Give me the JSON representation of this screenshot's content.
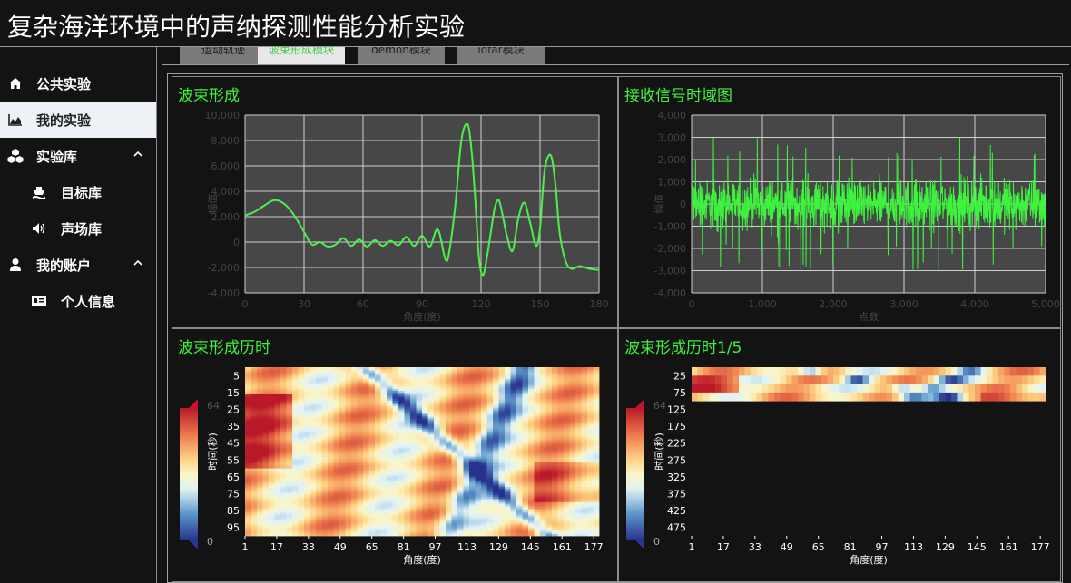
{
  "app": {
    "title": "复杂海洋环境中的声纳探测性能分析实验"
  },
  "sidebar": {
    "items": [
      {
        "label": "公共实验",
        "icon": "home-icon",
        "active": false,
        "sub": false
      },
      {
        "label": "我的实验",
        "icon": "area-chart-icon",
        "active": true,
        "sub": false
      },
      {
        "label": "实验库",
        "icon": "cubes-icon",
        "active": false,
        "sub": false,
        "expanded": true
      },
      {
        "label": "目标库",
        "icon": "ship-icon",
        "active": false,
        "sub": true
      },
      {
        "label": "声场库",
        "icon": "volume-icon",
        "active": false,
        "sub": true
      },
      {
        "label": "我的账户",
        "icon": "user-icon",
        "active": false,
        "sub": false,
        "expanded": true
      },
      {
        "label": "个人信息",
        "icon": "id-card-icon",
        "active": false,
        "sub": true
      }
    ]
  },
  "tabs": [
    {
      "label": "运动轨迹",
      "active": false
    },
    {
      "label": "波束形成模块",
      "active": true
    },
    {
      "label": "demon模块",
      "active": false
    },
    {
      "label": "lofar模块",
      "active": false
    }
  ],
  "colors": {
    "accent_green": "#3ef23e",
    "background": "#131313",
    "plot_bg": "#474747"
  },
  "chart_data": [
    {
      "type": "line",
      "title": "波束形成",
      "xlabel": "角度(度)",
      "ylabel": "幅值",
      "xlim": [
        0,
        180
      ],
      "ylim": [
        -4000,
        10000
      ],
      "xticks": [
        "0",
        "30",
        "60",
        "90",
        "120",
        "150",
        "180"
      ],
      "yticks": [
        "10,000",
        "8,000",
        "6,000",
        "4,000",
        "2,000",
        "0",
        "-2,000",
        "-4,000"
      ],
      "grid": true,
      "series": [
        {
          "color": "#4cf04c",
          "x": [
            0,
            5,
            10,
            15,
            20,
            25,
            30,
            34,
            38,
            42,
            46,
            50,
            54,
            58,
            62,
            66,
            70,
            74,
            78,
            82,
            86,
            90,
            94,
            98,
            102,
            104,
            107,
            110,
            113,
            115,
            117,
            119,
            121,
            123,
            125,
            127,
            129,
            131,
            133,
            136,
            139,
            142,
            145,
            148,
            150,
            152,
            154,
            156,
            158,
            160,
            163,
            166,
            170,
            175,
            180
          ],
          "y": [
            2100,
            2400,
            2900,
            3300,
            3000,
            2100,
            800,
            -200,
            0,
            -350,
            -200,
            300,
            -300,
            200,
            -350,
            150,
            -300,
            100,
            -250,
            400,
            -300,
            500,
            -350,
            1000,
            -1400,
            -600,
            3000,
            8000,
            9300,
            7500,
            3500,
            -1300,
            -2600,
            -1200,
            800,
            2700,
            3300,
            2100,
            600,
            -700,
            1900,
            3100,
            1500,
            -300,
            1100,
            5200,
            6700,
            6600,
            4300,
            700,
            -1500,
            -2100,
            -1900,
            -2100,
            -2200
          ]
        }
      ]
    },
    {
      "type": "line",
      "title": "接收信号时域图",
      "xlabel": "点数",
      "ylabel": "幅值",
      "xlim": [
        0,
        5000
      ],
      "ylim": [
        -4000,
        4000
      ],
      "xticks": [
        "0",
        "1,000",
        "2,000",
        "3,000",
        "4,000",
        "5,000"
      ],
      "yticks": [
        "4,000",
        "3,000",
        "2,000",
        "1,000",
        "0",
        "-1,000",
        "-2,000",
        "-3,000",
        "-4,000"
      ],
      "grid": true,
      "series": [
        {
          "color": "#3ef23e",
          "points": 5000,
          "noise_amplitude": 1000,
          "peak_amplitude": 3000
        }
      ]
    },
    {
      "type": "heatmap",
      "title": "波束形成历时",
      "xlabel": "角度(度)",
      "ylabel": "时间(秒)",
      "xticks": [
        "1",
        "17",
        "33",
        "49",
        "65",
        "81",
        "97",
        "113",
        "129",
        "145",
        "161",
        "177"
      ],
      "yticks": [
        "5",
        "15",
        "25",
        "35",
        "45",
        "55",
        "65",
        "75",
        "85",
        "95"
      ],
      "colorbar": {
        "max": "64",
        "min": "0"
      },
      "rows": 100,
      "cols": 60
    },
    {
      "type": "heatmap",
      "title": "波束形成历时1/5",
      "xlabel": "角度(度)",
      "ylabel": "时间(秒)",
      "xticks": [
        "1",
        "17",
        "33",
        "49",
        "65",
        "81",
        "97",
        "113",
        "129",
        "145",
        "161",
        "177"
      ],
      "yticks": [
        "25",
        "75",
        "125",
        "175",
        "225",
        "275",
        "325",
        "375",
        "425",
        "475"
      ],
      "colorbar": {
        "max": "64",
        "min": "0"
      },
      "rows": 20,
      "cols": 60
    }
  ]
}
